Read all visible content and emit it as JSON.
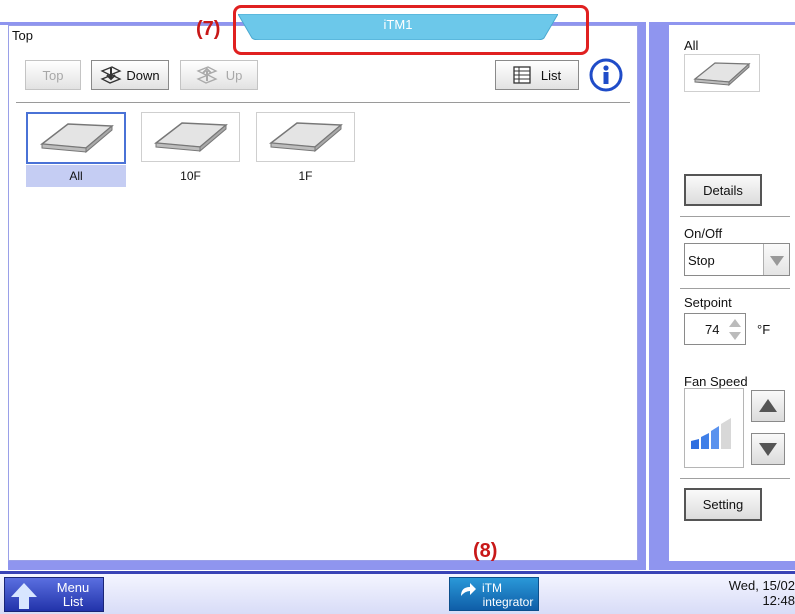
{
  "header": {
    "tab_title": "iTM1",
    "breadcrumb": "Top",
    "callout_top": "(7)"
  },
  "toolbar": {
    "top_label": "Top",
    "down_label": "Down",
    "up_label": "Up",
    "list_label": "List"
  },
  "areas": [
    {
      "label": "All",
      "selected": true
    },
    {
      "label": "10F",
      "selected": false
    },
    {
      "label": "1F",
      "selected": false
    }
  ],
  "side": {
    "selected_area": "All",
    "details_label": "Details",
    "onoff_label": "On/Off",
    "onoff_value": "Stop",
    "setpoint_label": "Setpoint",
    "setpoint_value": "74",
    "setpoint_unit": "°F",
    "fan_label": "Fan Speed",
    "setting_label": "Setting"
  },
  "bottom": {
    "menu_line1": "Menu",
    "menu_line2": "List",
    "itm_line1": "iTM",
    "itm_line2": "integrator",
    "callout_bottom": "(8)",
    "date": "Wed, 15/02",
    "time": "12:48"
  },
  "colors": {
    "frame": "#8f95ef",
    "tab": "#6cc8ea",
    "callout": "#e02020",
    "selection": "#4a72d6"
  }
}
